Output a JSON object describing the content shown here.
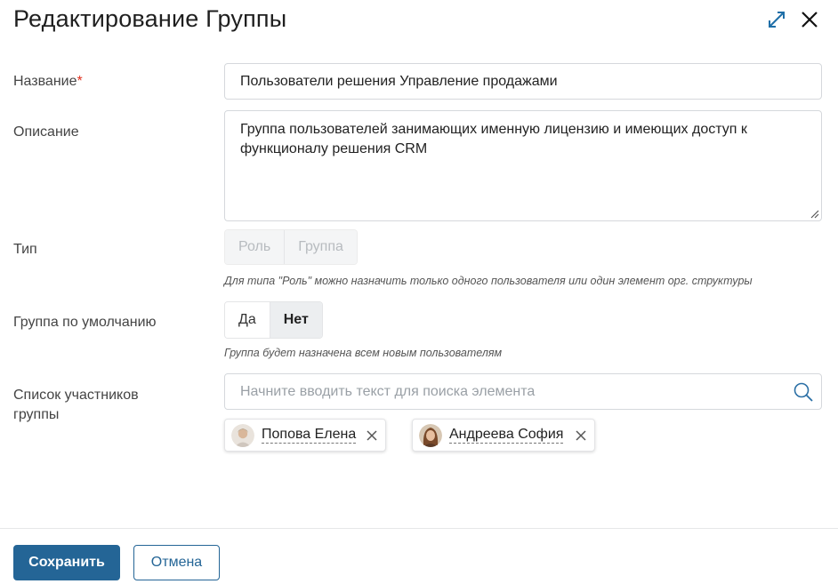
{
  "dialog": {
    "title": "Редактирование Группы"
  },
  "fields": {
    "name": {
      "label": "Название",
      "required_mark": "*",
      "value": "Пользователи решения Управление продажами"
    },
    "description": {
      "label": "Описание",
      "value": "Группа пользователей занимающих именную лицензию и имеющих доступ к функционалу решения CRM"
    },
    "type": {
      "label": "Тип",
      "options": [
        "Роль",
        "Группа"
      ],
      "disabled": true,
      "hint": "Для типа \"Роль\" можно назначить только одного пользователя или один элемент орг. структуры"
    },
    "default_group": {
      "label": "Группа по умолчанию",
      "options": [
        "Да",
        "Нет"
      ],
      "selected": "Нет",
      "hint": "Группа будет назначена всем новым пользователям"
    },
    "members": {
      "label_line1": "Список участников",
      "label_line2": "группы",
      "placeholder": "Начните вводить текст для поиска элемента",
      "chips": [
        {
          "name": "Попова Елена"
        },
        {
          "name": "Андреева София"
        }
      ]
    }
  },
  "footer": {
    "save_label": "Сохранить",
    "cancel_label": "Отмена"
  },
  "colors": {
    "primary": "#246596",
    "required": "#e0301e",
    "expand_icon": "#1f6fa8"
  }
}
